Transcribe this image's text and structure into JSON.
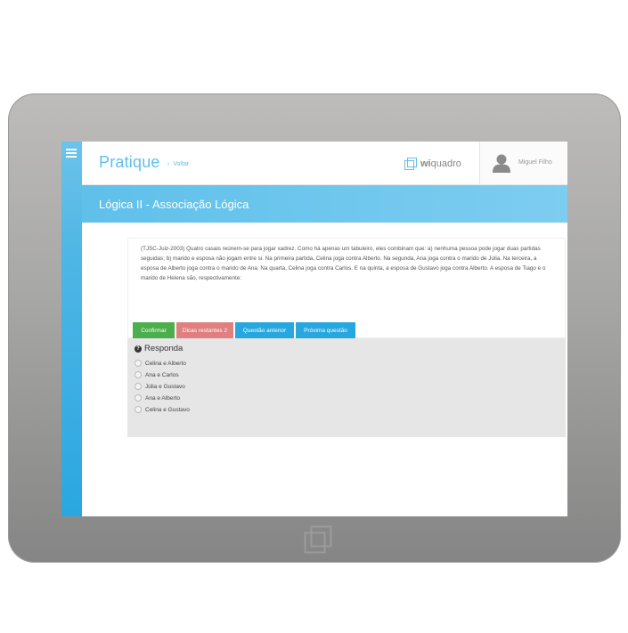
{
  "header": {
    "title": "Pratique",
    "back_label": "Voltar",
    "logo": {
      "prefix": "wi",
      "suffix": "quadro"
    },
    "user_name": "Miguel Filho"
  },
  "banner": {
    "title": "Lógica II - Associação Lógica"
  },
  "question": {
    "text": "(TJSC-Juiz-2003) Quatro casais reúnem-se para jogar xadrez. Como há apenas um tabuleiro, eles combinam que: a) nenhuma pessoa pode jogar duas partidas seguidas; b) marido e esposa não jogam entre si. Na primeira partida, Celina joga contra Alberto. Na segunda, Ana joga contra o marido de Júlia. Na terceira, a esposa de Alberto joga contra o marido de Ana. Na quarta, Celina joga contra Carlos. E na quinta, a esposa de Gustavo joga contra Alberto. A esposa de Tiago e o marido de Helena são, respectivamente:"
  },
  "answer": {
    "label": "Responda",
    "options": [
      "Celina e Alberto",
      "Ana e Carlos",
      "Júlia e Gustavo",
      "Ana e Alberto",
      "Celina e Gustavo"
    ]
  },
  "buttons": {
    "confirm": "Confirmar",
    "hints": "Dicas restantes 2",
    "prev": "Questão anterior",
    "next": "Próxima questão"
  },
  "colors": {
    "accent": "#5fc0ea",
    "confirm": "#4cae4c",
    "hints": "#e07f7f",
    "nav": "#27a7df"
  }
}
